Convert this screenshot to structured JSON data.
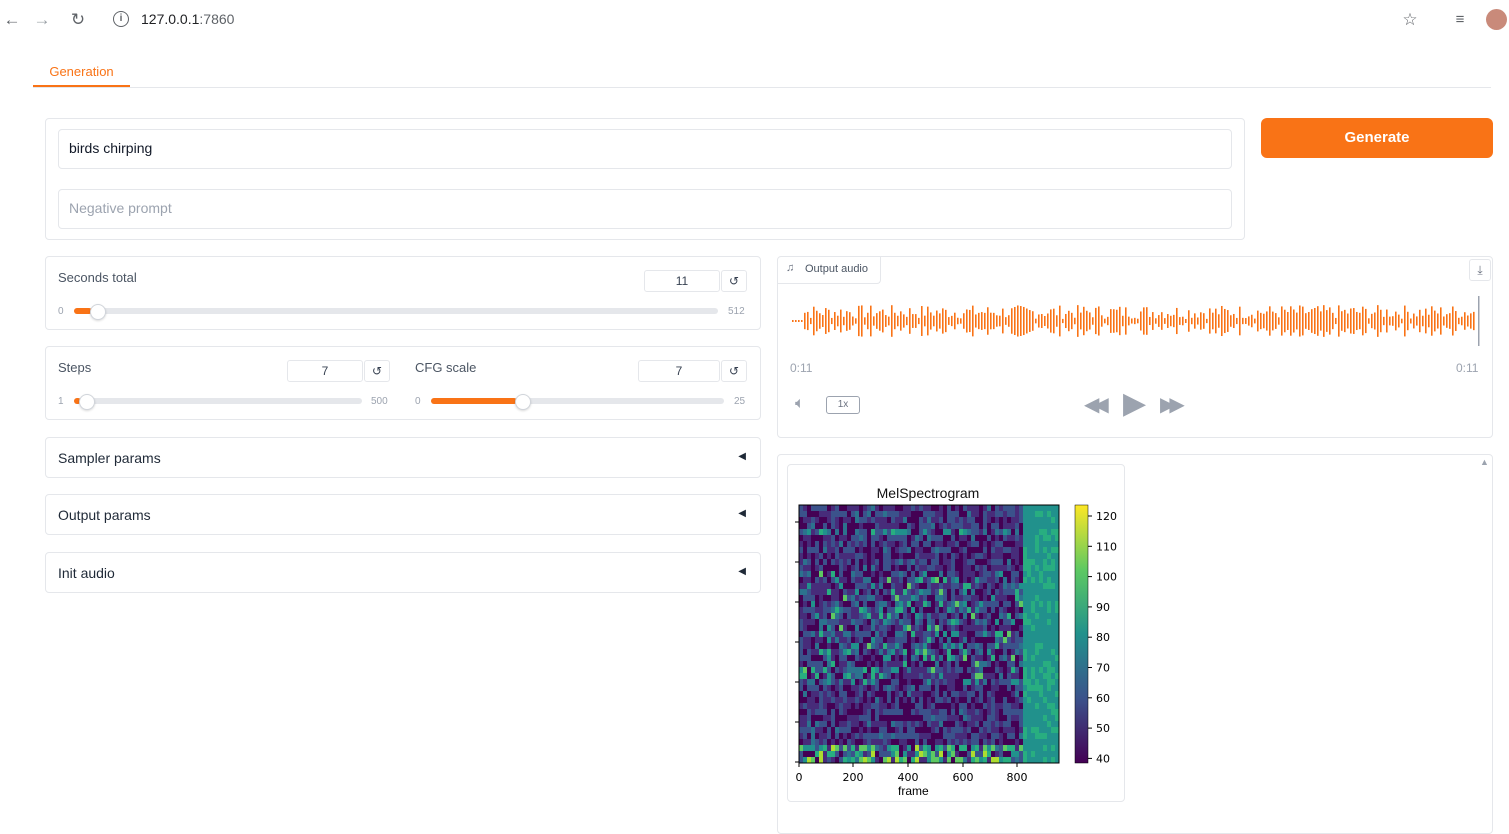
{
  "browser": {
    "url_host": "127.0.0.1",
    "url_port": ":7860"
  },
  "tabs": [
    {
      "label": "Generation",
      "active": true
    }
  ],
  "prompt": {
    "value": "birds chirping"
  },
  "negative_prompt": {
    "value": "",
    "placeholder": "Negative prompt"
  },
  "generate_label": "Generate",
  "seconds_total": {
    "label": "Seconds total",
    "value": "11",
    "min": "0",
    "max": "512",
    "fraction": 0.021
  },
  "steps": {
    "label": "Steps",
    "value": "7",
    "min": "1",
    "max": "500",
    "fraction": 0.012
  },
  "cfg_scale": {
    "label": "CFG scale",
    "value": "7",
    "min": "0",
    "max": "25",
    "fraction": 0.28
  },
  "reset_icon": "↺",
  "accordions": [
    {
      "label": "Sampler params"
    },
    {
      "label": "Output params"
    },
    {
      "label": "Init audio"
    }
  ],
  "audio": {
    "label": "Output audio",
    "time_current": "0:11",
    "time_total": "0:11",
    "speed": "1x"
  },
  "spectrogram": {
    "title": "MelSpectrogram",
    "xlabel": "frame",
    "x_ticks": [
      "0",
      "200",
      "400",
      "600",
      "800"
    ],
    "colorbar_ticks": [
      "120",
      "110",
      "100",
      "90",
      "80",
      "70",
      "60",
      "50",
      "40"
    ]
  },
  "colors": {
    "accent": "#f97316"
  }
}
